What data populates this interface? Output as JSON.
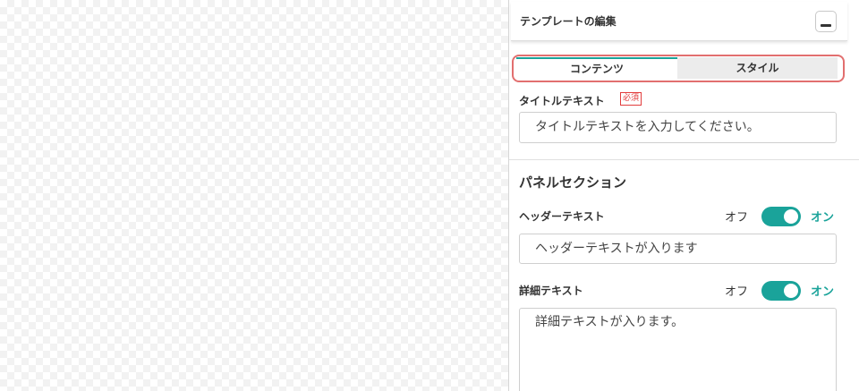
{
  "panel": {
    "title": "テンプレートの編集",
    "collapse_icon": "minus-icon"
  },
  "tabs": [
    {
      "label": "コンテンツ",
      "active": true
    },
    {
      "label": "スタイル",
      "active": false
    }
  ],
  "title_field": {
    "label": "タイトルテキスト",
    "required_badge": "必須",
    "placeholder": "タイトルテキストを入力してください。"
  },
  "panel_section": {
    "title": "パネルセクション",
    "header": {
      "label": "ヘッダーテキスト",
      "off_label": "オフ",
      "on_label": "オン",
      "enabled": true,
      "value": "ヘッダーテキストが入ります"
    },
    "detail": {
      "label": "詳細テキスト",
      "off_label": "オフ",
      "on_label": "オン",
      "enabled": true,
      "value": "詳細テキストが入ります。"
    }
  },
  "colors": {
    "accent": "#1aa39a",
    "highlight_outline": "#e26f6f",
    "required": "#e23c3c"
  }
}
